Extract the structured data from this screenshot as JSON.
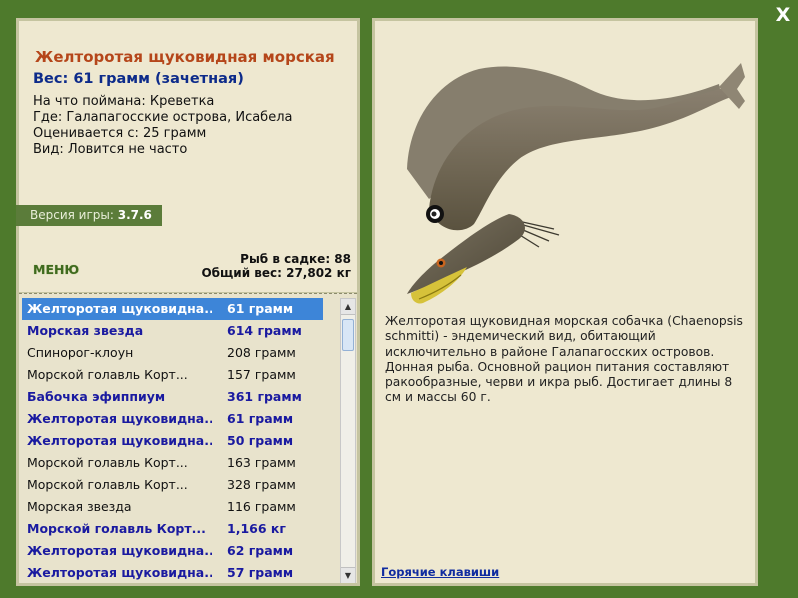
{
  "window": {
    "close_label": "X"
  },
  "catch": {
    "title": "Желторотая щуковидная морская",
    "weight": "Вес: 61 грамм (зачетная)",
    "bait": "На что поймана: Креветка",
    "location": "Где: Галапагосские острова, Исабела",
    "value": "Оценивается с: 25 грамм",
    "rarity": "Вид: Ловится не часто"
  },
  "version": {
    "label": "Версия игры:",
    "number": "3.7.6"
  },
  "menu_label": "МЕНЮ",
  "stats": {
    "count": "Рыб в садке: 88",
    "total_weight": "Общий вес: 27,802 кг"
  },
  "fish_list": [
    {
      "name": "Желторотая щуковидна...",
      "weight": "61 грамм"
    },
    {
      "name": "Морская звезда",
      "weight": "614 грамм"
    },
    {
      "name": "Спинорог-клоун",
      "weight": "208 грамм"
    },
    {
      "name": "Морской голавль Корт...",
      "weight": "157 грамм"
    },
    {
      "name": "Бабочка эфиппиум",
      "weight": "361 грамм"
    },
    {
      "name": "Желторотая щуковидна...",
      "weight": "61 грамм"
    },
    {
      "name": "Желторотая щуковидна...",
      "weight": "50 грамм"
    },
    {
      "name": "Морской голавль Корт...",
      "weight": "163 грамм"
    },
    {
      "name": "Морской голавль Корт...",
      "weight": "328 грамм"
    },
    {
      "name": "Морская звезда",
      "weight": "116 грамм"
    },
    {
      "name": "Морской голавль Корт...",
      "weight": "1,166 кг"
    },
    {
      "name": "Желторотая щуковидна...",
      "weight": "62 грамм"
    },
    {
      "name": "Желторотая щуковидна...",
      "weight": "57 грамм"
    }
  ],
  "description": "Желторотая щуковидная морская собачка (Chaenopsis schmitti) - эндемический вид, обитающий исключительно в районе Галапагосских островов. Донная рыба. Основной рацион питания составляют ракообразные, черви и икра рыб. Достигает длины 8 см и массы 60 г.",
  "hotkeys_label": "Горячие клавиши"
}
